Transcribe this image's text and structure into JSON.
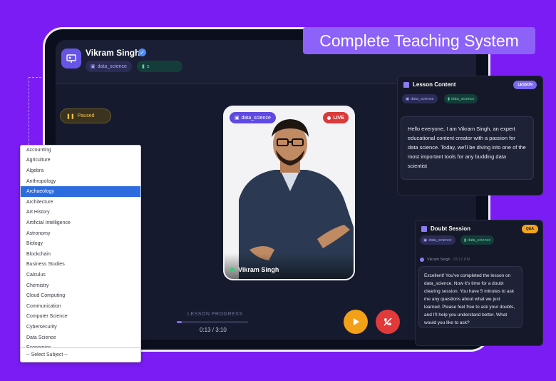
{
  "banner": "Complete Teaching System",
  "header": {
    "teacher_name": "Vikram Singh",
    "subject_chip": "data_science",
    "level_chip": "s"
  },
  "status": {
    "paused": "Paused"
  },
  "video": {
    "subject_chip": "data_science",
    "live": "LIVE",
    "name": "Vikram Singh"
  },
  "progress": {
    "label": "LESSON PROGRESS",
    "time": "0:13 / 3:10",
    "fraction": 0.07
  },
  "lesson_panel": {
    "title": "Lesson Content",
    "badge": "LESSON",
    "subject_chip": "data_science",
    "level_chip": "data_science",
    "text": "Hello everyone, I am Vikram Singh, an expert educational content creator with a passion for data science. Today, we'll be diving into one of the most important tools for any budding data scientist"
  },
  "doubt_panel": {
    "title": "Doubt Session",
    "badge": "Q&A",
    "subject_chip": "data_science",
    "level_chip": "data_science",
    "sender": "Vikram Singh",
    "time": "03:12 PM",
    "text": "Excellent! You've completed the lesson on data_science. Now it's time for a doubt clearing session. You have 5 minutes to ask me any questions about what we just learned. Please feel free to ask your doubts, and I'll help you understand better. What would you like to ask?"
  },
  "subjects": {
    "items": [
      "Accounting",
      "Agriculture",
      "Algebra",
      "Anthropology",
      "Archaeology",
      "Architecture",
      "Art History",
      "Artificial Intelligence",
      "Astronomy",
      "Biology",
      "Blockchain",
      "Business Studies",
      "Calculus",
      "Chemistry",
      "Cloud Computing",
      "Communication",
      "Computer Science",
      "Cybersecurity",
      "Data Science",
      "Economics"
    ],
    "selected_index": 4,
    "select_placeholder": "-- Select Subject --"
  },
  "colors": {
    "background": "#7b1cf4",
    "accent": "#6655e6",
    "live": "#d93a3a",
    "play": "#f2a018",
    "selected": "#2d6cdf"
  }
}
